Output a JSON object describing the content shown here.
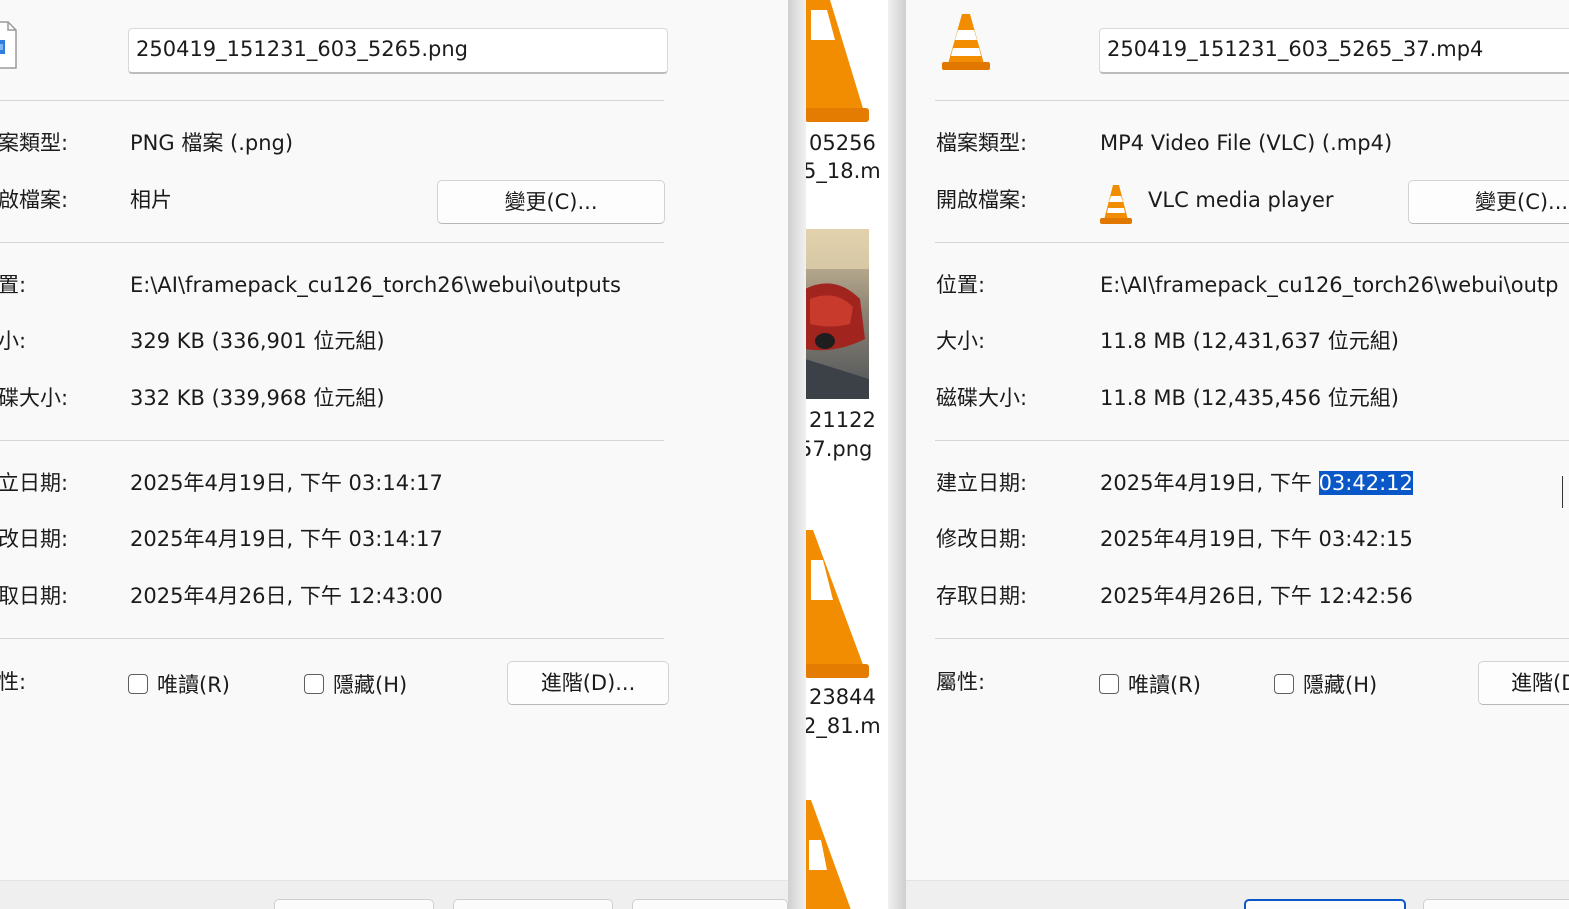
{
  "left": {
    "filename": "250419_151231_603_5265.png",
    "file_type_label": "案類型:",
    "file_type_value": "PNG 檔案 (.png)",
    "opens_with_label": "啟檔案:",
    "opens_with_value": "相片",
    "change_button": "變更(C)...",
    "location_label": "置:",
    "location_value": "E:\\AI\\framepack_cu126_torch26\\webui\\outputs",
    "size_label": "小:",
    "size_value": "329 KB (336,901 位元組)",
    "disk_size_label": "碟大小:",
    "disk_size_value": "332 KB (339,968 位元組)",
    "created_label": "立日期:",
    "created_value": "2025年4月19日, 下午 03:14:17",
    "modified_label": "改日期:",
    "modified_value": "2025年4月19日, 下午 03:14:17",
    "accessed_label": "取日期:",
    "accessed_value": "2025年4月26日, 下午 12:43:00",
    "attributes_label": "性:",
    "readonly_label": "唯讀(R)",
    "hidden_label": "隱藏(H)",
    "advanced_button": "進階(D)..."
  },
  "middle": {
    "item1_line1": "05256",
    "item1_line2": "5_18.m",
    "item2_line1": "21122",
    "item2_line2": "57.png",
    "item3_line1": "23844",
    "item3_line2": "2_81.m"
  },
  "right": {
    "filename": "250419_151231_603_5265_37.mp4",
    "file_type_label": "檔案類型:",
    "file_type_value": "MP4 Video File (VLC) (.mp4)",
    "opens_with_label": "開啟檔案:",
    "opens_with_value": "VLC media player",
    "change_button": "變更(C)...",
    "location_label": "位置:",
    "location_value": "E:\\AI\\framepack_cu126_torch26\\webui\\outp",
    "size_label": "大小:",
    "size_value": "11.8 MB (12,431,637 位元組)",
    "disk_size_label": "磁碟大小:",
    "disk_size_value": "11.8 MB (12,435,456 位元組)",
    "created_label": "建立日期:",
    "created_value_prefix": "2025年4月19日, 下午 ",
    "created_value_selected": "03:42:12",
    "modified_label": "修改日期:",
    "modified_value": "2025年4月19日, 下午 03:42:15",
    "accessed_label": "存取日期:",
    "accessed_value": "2025年4月26日, 下午 12:42:56",
    "attributes_label": "屬性:",
    "readonly_label": "唯讀(R)",
    "hidden_label": "隱藏(H)",
    "advanced_button": "進階(D)..."
  },
  "colors": {
    "selection": "#0a58c7",
    "vlc_orange": "#f28c00"
  }
}
